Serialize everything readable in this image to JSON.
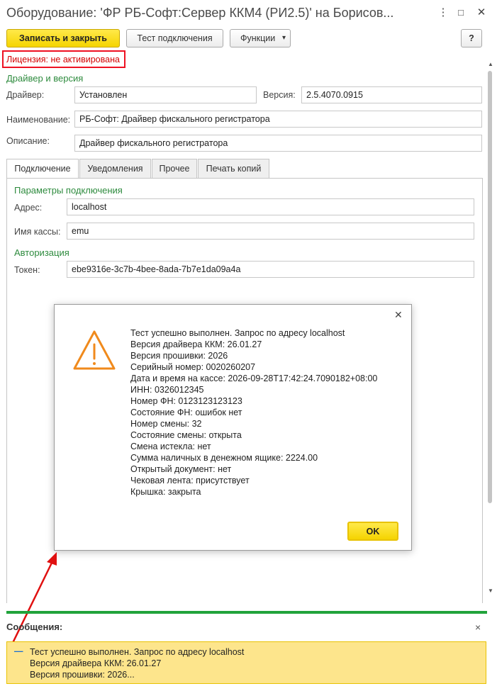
{
  "window": {
    "title": "Оборудование: 'ФР РБ-Софт:Сервер ККМ4 (РИ2.5)' на Борисов...",
    "more_icon": "⋮",
    "minimize_icon": "□",
    "close_icon": "✕"
  },
  "toolbar": {
    "save_close": "Записать и закрыть",
    "test_connection": "Тест подключения",
    "functions": "Функции",
    "functions_arrow": "▾",
    "help": "?"
  },
  "license": "Лицензия: не активирована",
  "driver_section": {
    "title": "Драйвер и версия",
    "driver_label": "Драйвер:",
    "driver_value": "Установлен",
    "version_label": "Версия:",
    "version_value": "2.5.4070.0915",
    "name_label": "Наименование:",
    "name_value": "РБ-Софт: Драйвер фискального регистратора",
    "desc_label": "Описание:",
    "desc_value": "Драйвер фискального регистратора"
  },
  "tabs": [
    "Подключение",
    "Уведомления",
    "Прочее",
    "Печать копий"
  ],
  "connection": {
    "params_title": "Параметры подключения",
    "address_label": "Адрес:",
    "address_value": "localhost",
    "register_label": "Имя кассы:",
    "register_value": "emu",
    "auth_title": "Авторизация",
    "token_label": "Токен:",
    "token_value": "ebe9316e-3c7b-4bee-8ada-7b7e1da09a4a"
  },
  "dialog": {
    "close_icon": "✕",
    "lines": [
      "Тест успешно выполнен. Запрос по адресу localhost",
      "Версия драйвера ККМ: 26.01.27",
      "Версия прошивки: 2026",
      "Серийный номер: 0020260207",
      "Дата и время на кассе: 2026-09-28T17:42:24.7090182+08:00",
      "ИНН: 0326012345",
      "Номер ФН: 0123123123123",
      "Состояние ФН: ошибок нет",
      "Номер смены: 32",
      "Состояние смены: открыта",
      "Смена истекла: нет",
      "Сумма наличных в денежном ящике: 2224.00",
      "Открытый документ: нет",
      "Чековая лента: присутствует",
      "Крышка: закрыта"
    ],
    "ok": "OK"
  },
  "messages": {
    "title": "Сообщения:",
    "close_icon": "×",
    "dash": "—",
    "lines": [
      "Тест успешно выполнен. Запрос по адресу localhost",
      "Версия драйвера ККМ: 26.01.27",
      "Версия прошивки: 2026..."
    ]
  },
  "colors": {
    "accent_yellow": "#f5d400",
    "license_red": "#d40000",
    "section_green": "#2e8b3e",
    "warning_orange": "#f08a1c",
    "message_bg": "#fde58c",
    "arrow_red": "#e01010"
  }
}
